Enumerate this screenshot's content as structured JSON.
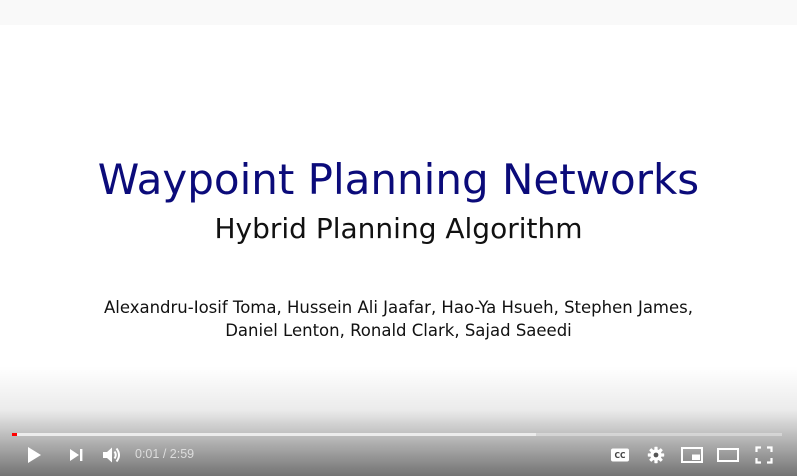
{
  "slide": {
    "title": "Waypoint Planning Networks",
    "subtitle": "Hybrid Planning Algorithm",
    "authors_line1": "Alexandru-Iosif Toma, Hussein Ali Jaafar, Hao-Ya Hsueh, Stephen James,",
    "authors_line2": "Daniel Lenton, Ronald Clark, Sajad Saeedi"
  },
  "player": {
    "current_time": "0:01",
    "separator": " / ",
    "duration": "2:59",
    "progress_played_fraction": 0.006,
    "progress_loaded_fraction": 0.68,
    "colors": {
      "played": "#ff0000",
      "title": "#0b0b7a"
    },
    "icons": [
      "play-icon",
      "next-icon",
      "volume-icon",
      "captions-icon",
      "settings-icon",
      "miniplayer-icon",
      "theater-icon",
      "fullscreen-icon"
    ]
  }
}
